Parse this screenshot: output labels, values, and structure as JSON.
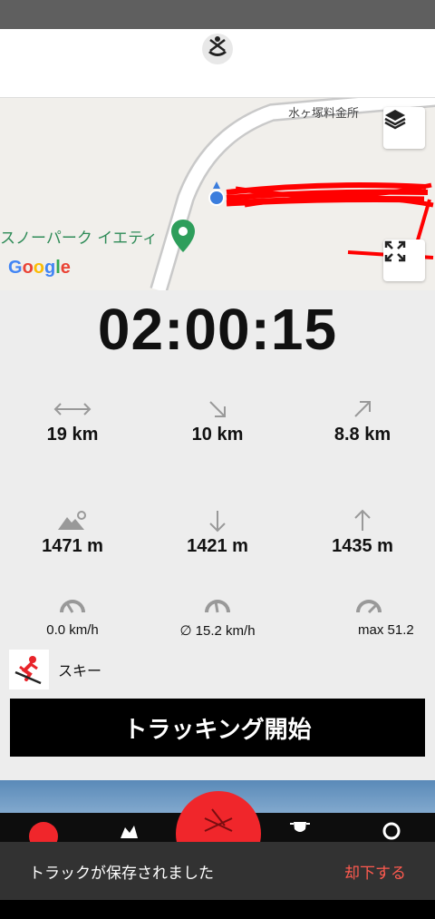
{
  "map": {
    "place_top": "水ヶ塚料金所",
    "place_poi": "スノーパーク イエティ",
    "provider": "Google"
  },
  "timer": "02:00:15",
  "stats": {
    "distance": "19 km",
    "downhill_distance": "10 km",
    "uphill_distance": "8.8 km",
    "altitude": "1471 m",
    "min_altitude": "1421 m",
    "max_altitude": "1435 m",
    "speed_current": "0.0 km/h",
    "speed_avg": "∅ 15.2 km/h",
    "speed_max": "max 51.2"
  },
  "activity": {
    "label": "スキー"
  },
  "start_button": "トラッキング開始",
  "snackbar": {
    "message": "トラックが保存されました",
    "action": "却下する"
  },
  "colors": {
    "accent": "#f0262b",
    "track": "#ff0000",
    "poi": "#2e8b57",
    "location": "#3b7ddd"
  }
}
